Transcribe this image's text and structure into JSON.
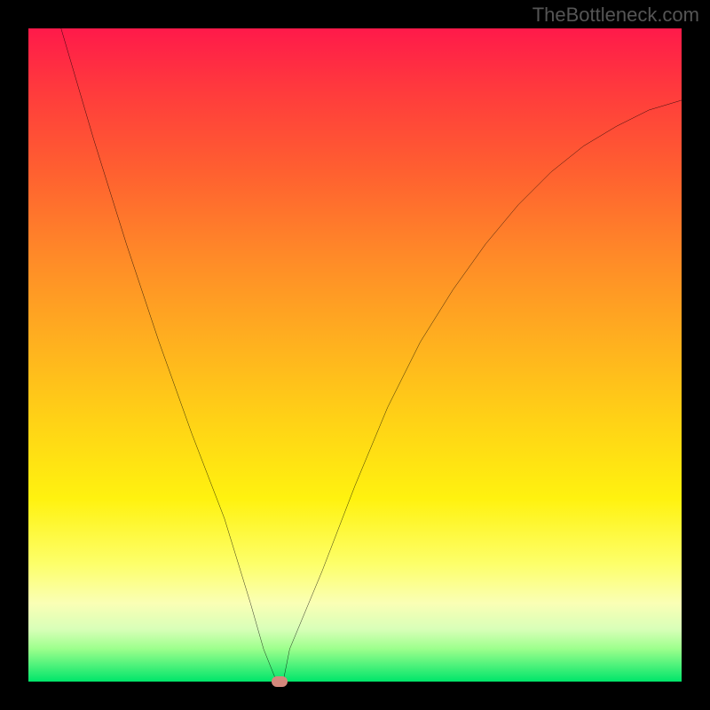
{
  "watermark": "TheBottleneck.com",
  "chart_data": {
    "type": "line",
    "title": "",
    "xlabel": "",
    "ylabel": "",
    "xlim": [
      0,
      100
    ],
    "ylim": [
      0,
      100
    ],
    "grid": false,
    "legend": false,
    "background": {
      "type": "vertical-gradient",
      "colors_top_to_bottom": [
        "#ff1a4a",
        "#ff8a28",
        "#fff20f",
        "#00e56a"
      ],
      "meaning": "bottleneck severity (red=high, green=low)"
    },
    "series": [
      {
        "name": "bottleneck-curve",
        "color": "#000000",
        "x": [
          5,
          10,
          15,
          20,
          25,
          30,
          34,
          36,
          38,
          39,
          40,
          45,
          50,
          55,
          60,
          65,
          70,
          75,
          80,
          85,
          90,
          95,
          100
        ],
        "y": [
          100,
          83,
          67,
          52,
          38,
          25,
          12,
          5,
          0,
          0,
          5,
          17,
          30,
          42,
          52,
          60,
          67,
          73,
          78,
          82,
          85,
          87.5,
          89
        ]
      }
    ],
    "annotations": [
      {
        "name": "minimum-point-marker",
        "x": 38.5,
        "y": 0,
        "shape": "rounded-rect",
        "color": "#d4887c"
      }
    ]
  }
}
